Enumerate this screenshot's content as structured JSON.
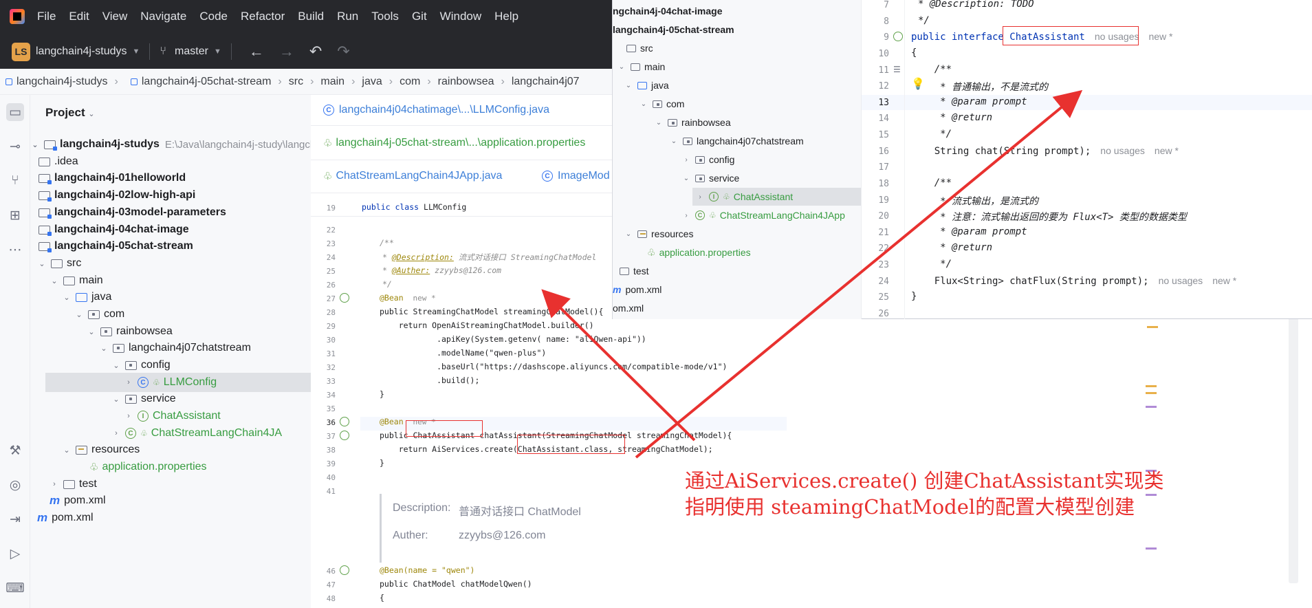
{
  "menu": [
    "File",
    "Edit",
    "View",
    "Navigate",
    "Code",
    "Refactor",
    "Build",
    "Run",
    "Tools",
    "Git",
    "Window",
    "Help"
  ],
  "toolbar": {
    "project_badge": "LS",
    "project_name": "langchain4j-studys",
    "branch": "master"
  },
  "breadcrumb": [
    "langchain4j-studys",
    "langchain4j-05chat-stream",
    "src",
    "main",
    "java",
    "com",
    "rainbowsea",
    "langchain4j07"
  ],
  "project_panel": {
    "title": "Project",
    "root": {
      "name": "langchain4j-studys",
      "path": "E:\\Java\\langchain4j-study\\langch"
    },
    "rows": [
      {
        "label": ".idea"
      },
      {
        "label": "langchain4j-01helloworld"
      },
      {
        "label": "langchain4j-02low-high-api"
      },
      {
        "label": "langchain4j-03model-parameters"
      },
      {
        "label": "langchain4j-04chat-image"
      },
      {
        "label": "langchain4j-05chat-stream"
      },
      {
        "label": "src"
      },
      {
        "label": "main"
      },
      {
        "label": "java"
      },
      {
        "label": "com"
      },
      {
        "label": "rainbowsea"
      },
      {
        "label": "langchain4j07chatstream"
      },
      {
        "label": "config"
      },
      {
        "label": "LLMConfig"
      },
      {
        "label": "service"
      },
      {
        "label": "ChatAssistant"
      },
      {
        "label": "ChatStreamLangChain4JA"
      },
      {
        "label": "resources"
      },
      {
        "label": "application.properties"
      },
      {
        "label": "test"
      },
      {
        "label": "pom.xml"
      },
      {
        "label": "pom.xml"
      }
    ]
  },
  "tabs": [
    {
      "label": "langchain4j04chatimage\\...\\LLMConfig.java"
    },
    {
      "label": "langchain4j-05chat-stream\\...\\application.properties"
    },
    {
      "label": "ChatStreamLangChain4JApp.java"
    },
    {
      "label": "ImageMod"
    }
  ],
  "editor": {
    "line19": "public class LLMConfig",
    "doc_desc_label": "@Description:",
    "doc_desc_text": " 流式对话接口 StreamingChatModel",
    "doc_auth_label": "@Auther:",
    "doc_auth_text": " zzyybs@126.com",
    "bean": "@Bean",
    "bean_hint": "new *",
    "l28": "public StreamingChatModel streamingChatModel(){",
    "l29": "    return OpenAiStreamingChatModel.builder()",
    "l30": "            .apiKey(System.getenv( name: \"aliQwen-api\"))",
    "l31": "            .modelName(\"qwen-plus\")",
    "l32": "            .baseUrl(\"https://dashscope.aliyuncs.com/compatible-mode/v1\")",
    "l33": "            .build();",
    "l34": "}",
    "l37": "public ChatAssistant chatAssistant(StreamingChatModel streamingChatModel){",
    "l38": "    return AiServices.create(ChatAssistant.class, streamingChatModel);",
    "l39": "}",
    "popup_desc_key": "Description:",
    "popup_desc_val": "普通对话接口 ChatModel",
    "popup_auth_key": "Auther:",
    "popup_auth_val": "zzyybs@126.com",
    "l46": "@Bean(name = \"qwen\")",
    "l47": "public ChatModel chatModelQwen()",
    "l48": "{"
  },
  "overlay": {
    "tree_rows": [
      "ngchain4j-04chat-image",
      "langchain4j-05chat-stream",
      "src",
      "main",
      "java",
      "com",
      "rainbowsea",
      "langchain4j07chatstream",
      "config",
      "service",
      "ChatAssistant",
      "ChatStreamLangChain4JApp",
      "resources",
      "application.properties",
      "test",
      "pom.xml",
      "om.xml"
    ],
    "code": {
      "l7": "* @Description: TODO",
      "l8": "*/",
      "l9": "public interface ChatAssistant",
      "l9_hint1": "no usages",
      "l9_hint2": "new *",
      "l10": "{",
      "l11": "    /**",
      "l12": "     * 普通输出，不是流式的",
      "l13": "     * @param prompt",
      "l14": "     * @return",
      "l15": "     */",
      "l16": "    String chat(String prompt);",
      "l16_hint1": "no usages",
      "l16_hint2": "new *",
      "l18": "    /**",
      "l19": "     * 流式输出，是流式的",
      "l20": "     * 注意：流式输出返回的要为 Flux<T> 类型的数据类型",
      "l21": "     * @param prompt",
      "l22": "     * @return",
      "l23": "     */",
      "l24": "    Flux<String> chatFlux(String prompt);",
      "l24_hint1": "no usages",
      "l24_hint2": "new *",
      "l25": "}"
    }
  },
  "annotation": {
    "line1": "通过AiServices.create() 创建ChatAssistant实现类",
    "line2": "指明使用 steamingChatModel的配置大模型创建"
  },
  "colors": {
    "annotation_red": "#e8312f",
    "titlebar": "#27282c",
    "accent": "#3574f0"
  }
}
